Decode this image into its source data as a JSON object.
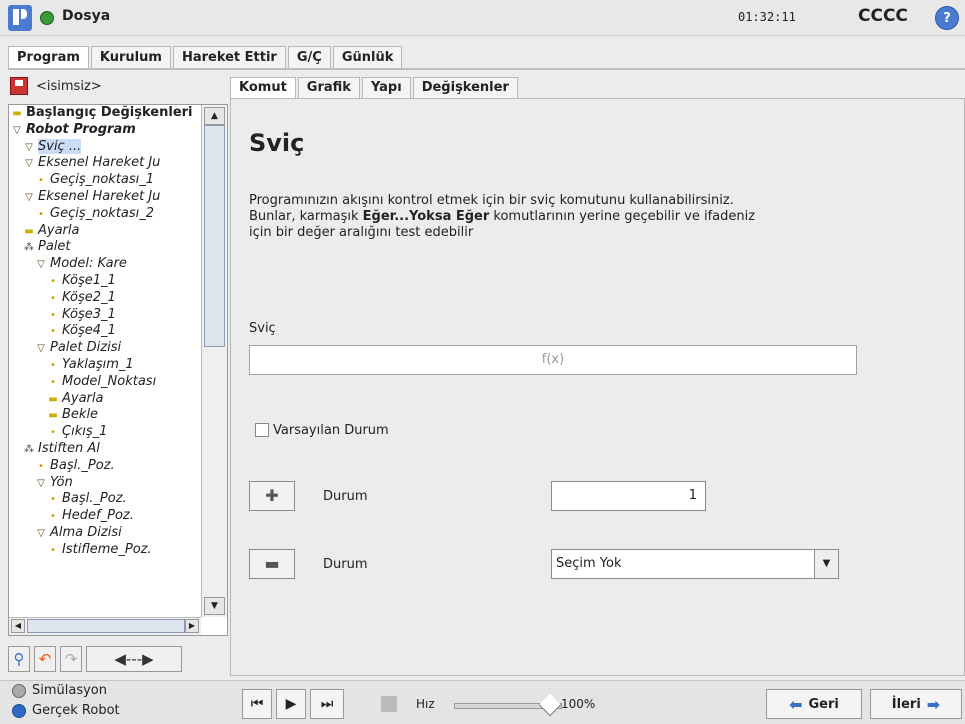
{
  "header": {
    "title": "Dosya",
    "time": "01:32:11",
    "robot_name": "CCCC",
    "help": "?"
  },
  "top_tabs": [
    "Program",
    "Kurulum",
    "Hareket Ettir",
    "G/Ç",
    "Günlük"
  ],
  "file": {
    "name": "<isimsiz>"
  },
  "tree": [
    {
      "label": "Başlangıç Değişkenleri",
      "level": 0,
      "icon": "▬",
      "style": "bold"
    },
    {
      "label": "Robot Program",
      "level": 0,
      "icon": "▽",
      "style": "bold it"
    },
    {
      "label": "Sviç ...",
      "level": 1,
      "icon": "▽",
      "style": "it sel"
    },
    {
      "label": "Eksenel Hareket Ju",
      "level": 1,
      "icon": "▽",
      "style": "it"
    },
    {
      "label": "Geçiş_noktası_1",
      "level": 2,
      "icon": "•",
      "style": "it"
    },
    {
      "label": "Eksenel Hareket Ju",
      "level": 1,
      "icon": "▽",
      "style": "it"
    },
    {
      "label": "Geçiş_noktası_2",
      "level": 2,
      "icon": "•",
      "style": "it"
    },
    {
      "label": "Ayarla",
      "level": 1,
      "icon": "▬",
      "style": "it"
    },
    {
      "label": "Palet",
      "level": 1,
      "icon": "⁂",
      "style": "it"
    },
    {
      "label": "Model: Kare",
      "level": 2,
      "icon": "▽",
      "style": "it"
    },
    {
      "label": "Köşe1_1",
      "level": 3,
      "icon": "•",
      "style": "it"
    },
    {
      "label": "Köşe2_1",
      "level": 3,
      "icon": "•",
      "style": "it"
    },
    {
      "label": "Köşe3_1",
      "level": 3,
      "icon": "•",
      "style": "it"
    },
    {
      "label": "Köşe4_1",
      "level": 3,
      "icon": "•",
      "style": "it"
    },
    {
      "label": "Palet Dizisi",
      "level": 2,
      "icon": "▽",
      "style": "it"
    },
    {
      "label": "Yaklaşım_1",
      "level": 3,
      "icon": "•",
      "style": "it"
    },
    {
      "label": "Model_Noktası",
      "level": 3,
      "icon": "•",
      "style": "it"
    },
    {
      "label": "Ayarla",
      "level": 3,
      "icon": "▬",
      "style": "it"
    },
    {
      "label": "Bekle",
      "level": 3,
      "icon": "▬",
      "style": "it"
    },
    {
      "label": "Çıkış_1",
      "level": 3,
      "icon": "•",
      "style": "it"
    },
    {
      "label": "İstiften Al",
      "level": 1,
      "icon": "⁂",
      "style": "it"
    },
    {
      "label": "Başl._Poz.",
      "level": 2,
      "icon": "•",
      "style": "it"
    },
    {
      "label": "Yön",
      "level": 2,
      "icon": "▽",
      "style": "it"
    },
    {
      "label": "Başl._Poz.",
      "level": 3,
      "icon": "•",
      "style": "it"
    },
    {
      "label": "Hedef_Poz.",
      "level": 3,
      "icon": "•",
      "style": "it"
    },
    {
      "label": "Alma Dizisi",
      "level": 2,
      "icon": "▽",
      "style": "it"
    },
    {
      "label": "İstifleme_Poz.",
      "level": 3,
      "icon": "•",
      "style": "it"
    }
  ],
  "content_tabs": [
    "Komut",
    "Grafik",
    "Yapı",
    "Değişkenler"
  ],
  "main": {
    "title": "Sviç",
    "desc_1": "Programınızın akışını kontrol etmek için bir sviç komutunu kullanabilirsiniz.",
    "desc_2a": "Bunlar, karmaşık ",
    "desc_2b": "Eğer...Yoksa Eğer",
    "desc_2c": " komutlarının yerine geçebilir ve ifadeniz",
    "desc_3": "için bir değer aralığını test edebilir",
    "switch_label": "Sviç",
    "expr_placeholder": "f(x)",
    "default_case_label": "Varsayılan Durum",
    "case_label": "Durum",
    "case_value": "1",
    "remove_case_label": "Durum",
    "remove_case_select": "Seçim Yok"
  },
  "footer": {
    "sim_mode": "Simülasyon",
    "real_mode": "Gerçek Robot",
    "speed_label": "Hız",
    "speed_value": "100%",
    "speed_fraction": 1.0,
    "back_label": "Geri",
    "next_label": "İleri"
  }
}
